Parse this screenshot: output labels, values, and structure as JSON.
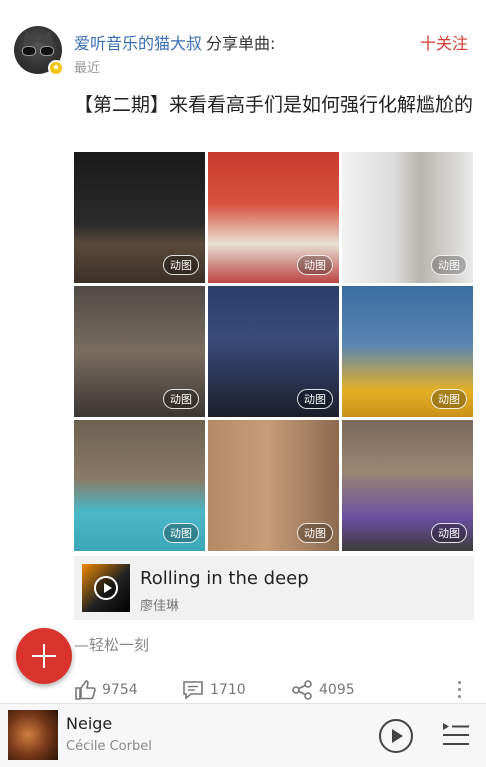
{
  "post": {
    "author": "爱听音乐的猫大叔",
    "action": "分享单曲:",
    "time": "最近",
    "follow_label": "十关注",
    "title": "【第二期】来看看高手们是如何强行化解尴尬的",
    "gif_label": "动图",
    "media_count": 9,
    "music": {
      "song": "Rolling in the deep",
      "artist": "廖佳琳"
    },
    "tagline": "—轻松一刻",
    "stats": {
      "likes": "9754",
      "comments": "1710",
      "shares": "4095"
    }
  },
  "player": {
    "title": "Neige",
    "artist": "Cécile Corbel"
  },
  "icons": {
    "fab": "add-icon",
    "like": "thumbs-up-icon",
    "comment": "comment-icon",
    "share": "share-icon",
    "more": "more-vertical-icon",
    "play": "play-icon",
    "queue": "playlist-icon"
  },
  "colors": {
    "accent": "#d9332e",
    "link": "#3a6eb5",
    "badge": "#f5c400"
  }
}
